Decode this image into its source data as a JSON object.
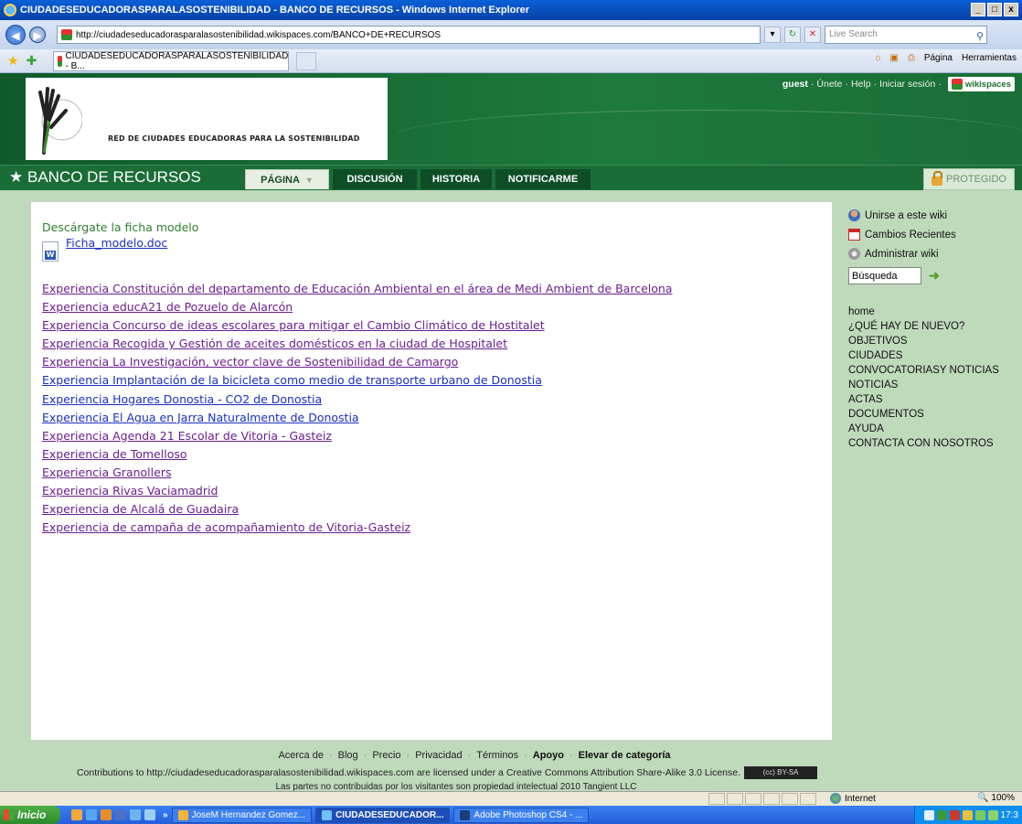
{
  "window": {
    "title": "CIUDADESEDUCADORASPARALASOSTENIBILIDAD - BANCO DE RECURSOS - Windows Internet Explorer",
    "min_glyph": "_",
    "max_glyph": "□",
    "close_glyph": "x"
  },
  "browser": {
    "url": "http://ciudadeseducadorasparalasostenibilidad.wikispaces.com/BANCO+DE+RECURSOS",
    "search_placeholder": "Live Search",
    "tab_title": "CIUDADESEDUCADORASPARALASOSTENIBILIDAD - B...",
    "cmd_pagina": "Página",
    "cmd_herramientas": "Herramientas"
  },
  "site": {
    "logo_text": "RED DE CIUDADES EDUCADORAS PARA LA SOSTENIBILIDAD",
    "user": "guest",
    "user_links": [
      "Únete",
      "Help",
      "Iniciar sesión"
    ],
    "wikispaces_badge": "wikispaces",
    "page_title": "BANCO DE RECURSOS",
    "tabs": [
      {
        "label": "PÁGINA"
      },
      {
        "label": "DISCUSIÓN"
      },
      {
        "label": "HISTORIA"
      },
      {
        "label": "NOTIFICARME"
      }
    ],
    "protected_label": "PROTEGIDO"
  },
  "content": {
    "download_heading": "Descárgate la ficha modelo",
    "download_file": "Ficha_modelo.doc",
    "experiences": [
      {
        "label": "Experiencia Constitución del departamento de Educación Ambiental en el área de Medi Ambient de Barcelona",
        "visited": true
      },
      {
        "label": "Experiencia educA21 de Pozuelo de Alarcón",
        "visited": true
      },
      {
        "label": "Experiencia Concurso de ideas escolares para mitigar el Cambio Climático de Hostitalet",
        "visited": true
      },
      {
        "label": "Experiencia Recogida y Gestión de aceites domésticos en la ciudad de Hospitalet",
        "visited": true
      },
      {
        "label": "Experiencia La Investigación, vector clave de Sostenibilidad de Camargo",
        "visited": true
      },
      {
        "label": "Experiencia Implantación de la bicicleta como medio de transporte urbano de Donostia",
        "visited": false
      },
      {
        "label": "Experiencia Hogares Donostia - CO2 de Donostia",
        "visited": false
      },
      {
        "label": "Experiencia El Agua en Jarra Naturalmente de Donostia",
        "visited": false
      },
      {
        "label": "Experiencia Agenda 21 Escolar de Vitoria - Gasteiz",
        "visited": true
      },
      {
        "label": "Experiencia de Tomelloso",
        "visited": true
      },
      {
        "label": "Experiencia Granollers",
        "visited": true
      },
      {
        "label": "Experiencia Rivas Vaciamadrid",
        "visited": true
      },
      {
        "label": "Experiencia de Alcalá de Guadaira",
        "visited": true
      },
      {
        "label": "Experiencia de campaña de acompañamiento de Vitoria-Gasteiz",
        "visited": true
      }
    ]
  },
  "sidebar": {
    "actions": [
      {
        "label": "Unirse a este wiki",
        "icon": "users-icon"
      },
      {
        "label": "Cambios Recientes",
        "icon": "calendar-icon"
      },
      {
        "label": "Administrar wiki",
        "icon": "gear-icon"
      }
    ],
    "search_value": "Búsqueda",
    "nav": [
      "home",
      "¿QUÉ HAY DE NUEVO?",
      "OBJETIVOS",
      "CIUDADES",
      "CONVOCATORIASY NOTICIAS",
      "NOTICIAS",
      "ACTAS",
      "DOCUMENTOS",
      "AYUDA",
      "CONTACTA CON NOSOTROS"
    ]
  },
  "footer": {
    "links": [
      "Acerca de",
      "Blog",
      "Precio",
      "Privacidad",
      "Términos"
    ],
    "bold_links": [
      "Apoyo",
      "Elevar de categoría"
    ],
    "license": "Contributions to http://ciudadeseducadorasparalasostenibilidad.wikispaces.com are licensed under a Creative Commons Attribution Share-Alike 3.0 License.",
    "cc_badge": "(cc) BY-SA",
    "copyright": "Las partes no contribuidas por los visitantes son propiedad intelectual 2010 Tangient LLC"
  },
  "statusbar": {
    "zone": "Internet",
    "zoom": "100%"
  },
  "taskbar": {
    "start": "Inicio",
    "tasks": [
      {
        "label": "JoseM Hernandez Gomez...",
        "active": false
      },
      {
        "label": "CIUDADESEDUCADOR...",
        "active": true
      },
      {
        "label": "Adobe Photoshop CS4 - ...",
        "active": false
      }
    ],
    "clock": "17:3"
  },
  "colors": {
    "header_green": "#1b6d38",
    "page_bg": "#bfd9bb",
    "visited_link": "#6b1f8f",
    "unvisited_link": "#1b2fc2",
    "heading_green": "#2f7f2e"
  }
}
